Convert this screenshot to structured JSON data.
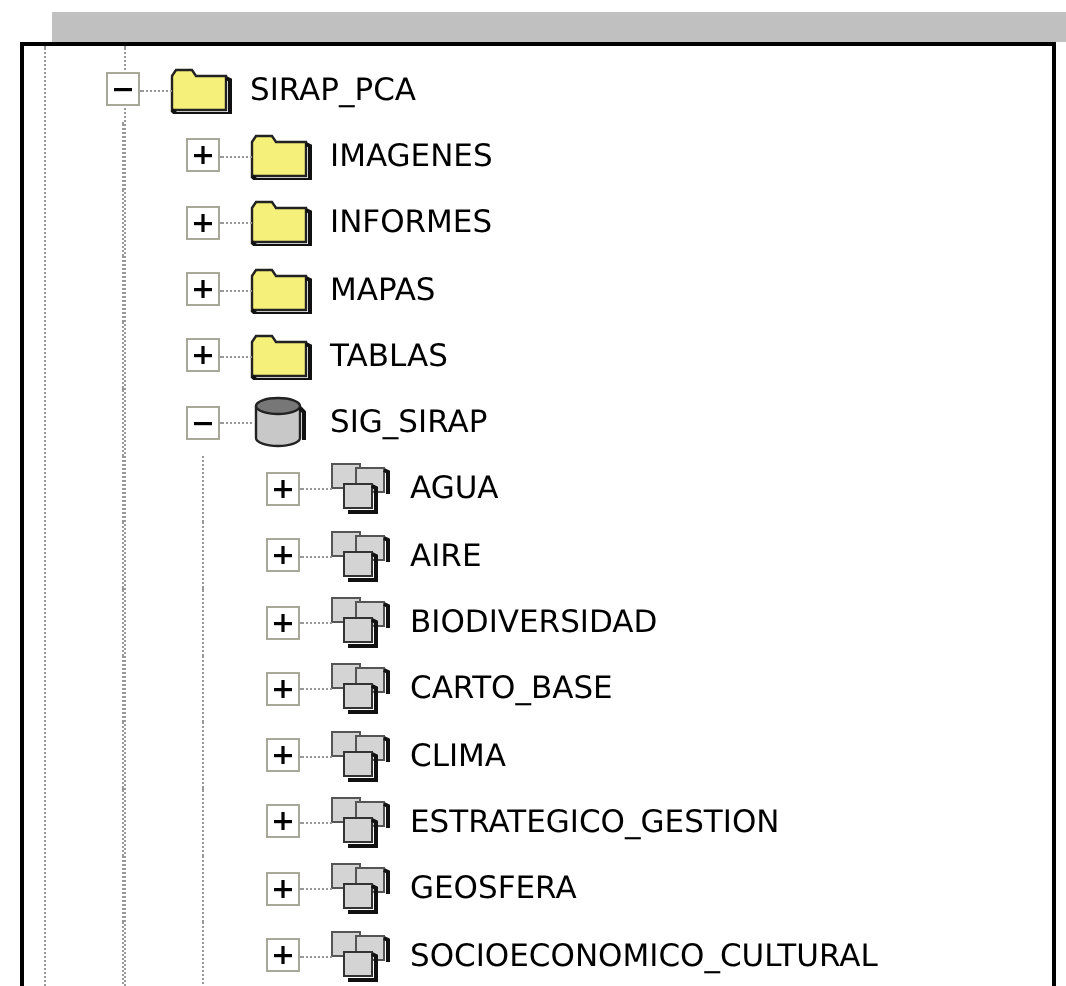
{
  "tree": [
    {
      "label": "SIRAP_PCA",
      "kind": "folder",
      "expanded": true,
      "children": [
        {
          "label": "IMAGENES",
          "kind": "folder",
          "expanded": false
        },
        {
          "label": "INFORMES",
          "kind": "folder",
          "expanded": false
        },
        {
          "label": "MAPAS",
          "kind": "folder",
          "expanded": false
        },
        {
          "label": "TABLAS",
          "kind": "folder",
          "expanded": false
        },
        {
          "label": "SIG_SIRAP",
          "kind": "database",
          "expanded": true,
          "children": [
            {
              "label": "AGUA",
              "kind": "dataset",
              "expanded": false
            },
            {
              "label": "AIRE",
              "kind": "dataset",
              "expanded": false
            },
            {
              "label": "BIODIVERSIDAD",
              "kind": "dataset",
              "expanded": false
            },
            {
              "label": "CARTO_BASE",
              "kind": "dataset",
              "expanded": false
            },
            {
              "label": "CLIMA",
              "kind": "dataset",
              "expanded": false
            },
            {
              "label": "ESTRATEGICO_GESTION",
              "kind": "dataset",
              "expanded": false
            },
            {
              "label": "GEOSFERA",
              "kind": "dataset",
              "expanded": false
            },
            {
              "label": "SOCIOECONOMICO_CULTURAL",
              "kind": "dataset",
              "expanded": false
            }
          ]
        }
      ]
    }
  ]
}
